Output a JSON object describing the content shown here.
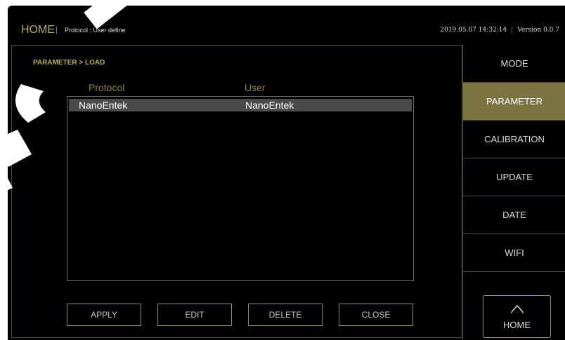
{
  "header": {
    "home": "HOME",
    "separator": "|",
    "protocol": "Protocol : User define",
    "datetime": "2019.05.07 14:32:14",
    "version": "Version 0.0.7"
  },
  "main": {
    "breadcrumb": "PARAMETER > LOAD",
    "columns": {
      "protocol": "Protocol",
      "user": "User"
    },
    "rows": [
      {
        "protocol": "NanoEntek",
        "user": "NanoEntek"
      }
    ],
    "buttons": {
      "apply": "APPLY",
      "edit": "EDIT",
      "delete": "DELETE",
      "close": "CLOSE"
    }
  },
  "sidebar": {
    "items": [
      {
        "label": "MODE"
      },
      {
        "label": "PARAMETER",
        "active": true
      },
      {
        "label": "CALIBRATION"
      },
      {
        "label": "UPDATE"
      },
      {
        "label": "DATE"
      },
      {
        "label": "WIFI"
      }
    ],
    "home": "HOME",
    "home_icon": "home-icon"
  },
  "colors": {
    "accent": "#b7ad5f",
    "active_bg": "#7b7441",
    "border": "#524c26",
    "background": "#000000"
  }
}
